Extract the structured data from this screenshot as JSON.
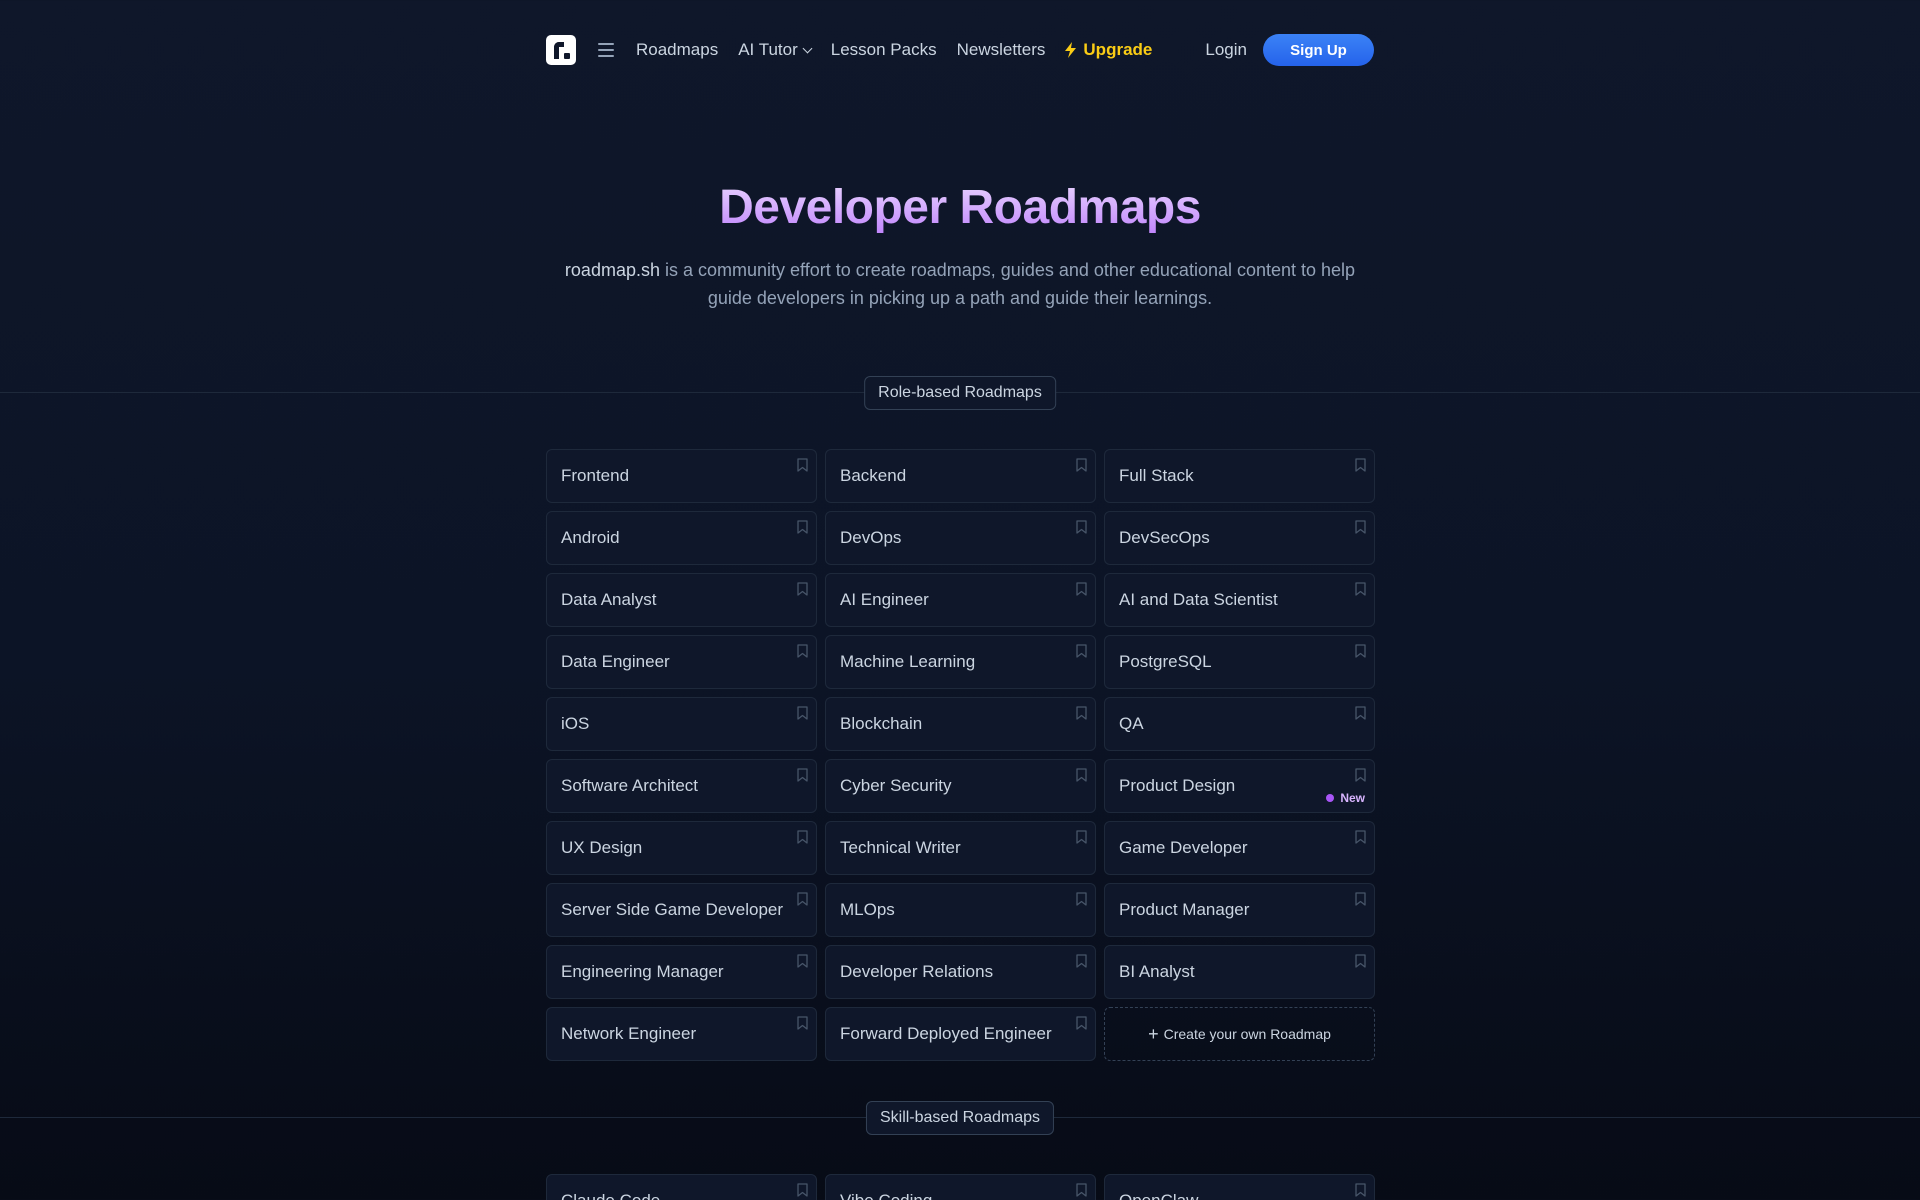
{
  "nav": {
    "links": {
      "roadmaps": "Roadmaps",
      "ai_tutor": "AI Tutor",
      "lesson_packs": "Lesson Packs",
      "newsletters": "Newsletters"
    },
    "upgrade": "Upgrade",
    "login": "Login",
    "signup": "Sign Up"
  },
  "hero": {
    "title": "Developer Roadmaps",
    "brand": "roadmap.sh",
    "description": " is a community effort to create roadmaps, guides and other educational content to help guide developers in picking up a path and guide their learnings."
  },
  "role_section": {
    "label": "Role-based Roadmaps",
    "items": [
      {
        "label": "Frontend"
      },
      {
        "label": "Backend"
      },
      {
        "label": "Full Stack"
      },
      {
        "label": "Android"
      },
      {
        "label": "DevOps"
      },
      {
        "label": "DevSecOps"
      },
      {
        "label": "Data Analyst"
      },
      {
        "label": "AI Engineer"
      },
      {
        "label": "AI and Data Scientist"
      },
      {
        "label": "Data Engineer"
      },
      {
        "label": "Machine Learning"
      },
      {
        "label": "PostgreSQL"
      },
      {
        "label": "iOS"
      },
      {
        "label": "Blockchain"
      },
      {
        "label": "QA"
      },
      {
        "label": "Software Architect"
      },
      {
        "label": "Cyber Security"
      },
      {
        "label": "Product Design",
        "badge": "New"
      },
      {
        "label": "UX Design"
      },
      {
        "label": "Technical Writer"
      },
      {
        "label": "Game Developer"
      },
      {
        "label": "Server Side Game Developer"
      },
      {
        "label": "MLOps"
      },
      {
        "label": "Product Manager"
      },
      {
        "label": "Engineering Manager"
      },
      {
        "label": "Developer Relations"
      },
      {
        "label": "BI Analyst"
      },
      {
        "label": "Network Engineer"
      },
      {
        "label": "Forward Deployed Engineer"
      }
    ],
    "create_label": "Create your own Roadmap"
  },
  "skill_section": {
    "label": "Skill-based Roadmaps",
    "items": [
      {
        "label": "Claude Code"
      },
      {
        "label": "Vibe Coding"
      },
      {
        "label": "OpenClaw"
      }
    ]
  },
  "colors": {
    "accent": "#2563eb",
    "upgrade": "#facc15",
    "title": "#c084fc",
    "badge_dot": "#a855f7"
  }
}
